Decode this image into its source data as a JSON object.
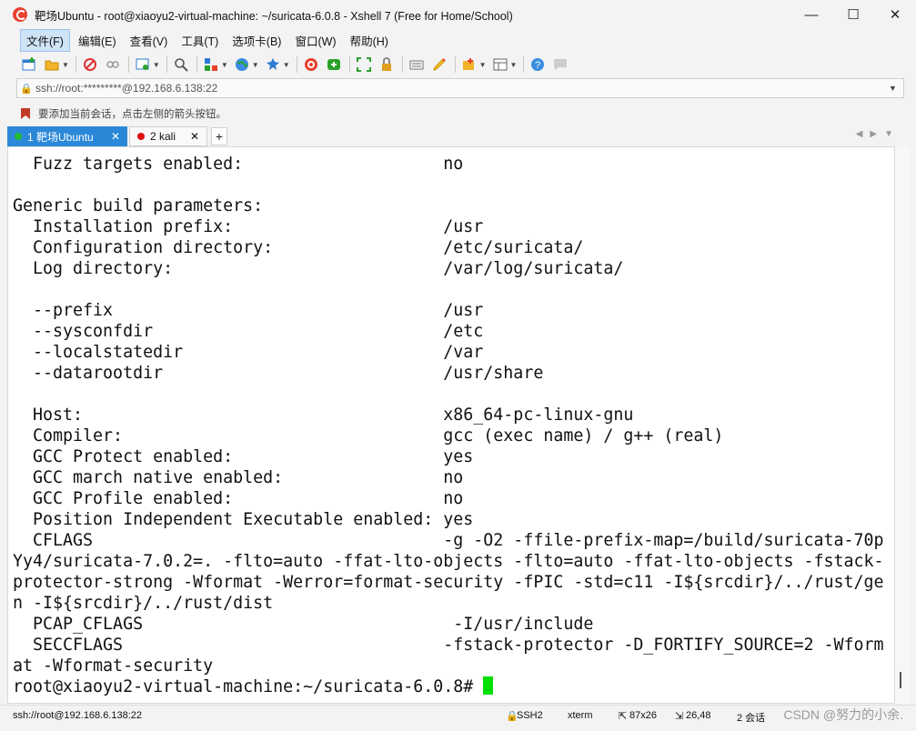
{
  "window": {
    "title": "靶场Ubuntu - root@xiaoyu2-virtual-machine: ~/suricata-6.0.8 - Xshell 7 (Free for Home/School)",
    "minimize": "—",
    "maximize": "☐",
    "close": "✕"
  },
  "menu": {
    "items": [
      "文件(F)",
      "编辑(E)",
      "查看(V)",
      "工具(T)",
      "选项卡(B)",
      "窗口(W)",
      "帮助(H)"
    ]
  },
  "address": {
    "value": "ssh://root:*********@192.168.6.138:22"
  },
  "hint": {
    "text": "要添加当前会话，点击左侧的箭头按钮。"
  },
  "tabs": [
    {
      "label": "1 靶场Ubuntu",
      "close": "✕",
      "dot_color": "#22bb33"
    },
    {
      "label": "2 kali",
      "close": "✕",
      "dot_color": "#e01010"
    }
  ],
  "tab_add": "+",
  "terminal": {
    "lines": [
      "  Fuzz targets enabled:                    no",
      "",
      "Generic build parameters:",
      "  Installation prefix:                     /usr",
      "  Configuration directory:                 /etc/suricata/",
      "  Log directory:                           /var/log/suricata/",
      "",
      "  --prefix                                 /usr",
      "  --sysconfdir                             /etc",
      "  --localstatedir                          /var",
      "  --datarootdir                            /usr/share",
      "",
      "  Host:                                    x86_64-pc-linux-gnu",
      "  Compiler:                                gcc (exec name) / g++ (real)",
      "  GCC Protect enabled:                     yes",
      "  GCC march native enabled:                no",
      "  GCC Profile enabled:                     no",
      "  Position Independent Executable enabled: yes",
      "  CFLAGS                                   -g -O2 -ffile-prefix-map=/build/suricata-70p",
      "Yy4/suricata-7.0.2=. -flto=auto -ffat-lto-objects -flto=auto -ffat-lto-objects -fstack-",
      "protector-strong -Wformat -Werror=format-security -fPIC -std=c11 -I${srcdir}/../rust/ge",
      "n -I${srcdir}/../rust/dist",
      "  PCAP_CFLAGS                               -I/usr/include",
      "  SECCFLAGS                                -fstack-protector -D_FORTIFY_SOURCE=2 -Wform",
      "at -Wformat-security"
    ],
    "prompt": "root@xiaoyu2-virtual-machine:~/suricata-6.0.8# "
  },
  "status": {
    "connection": "ssh://root@192.168.6.138:22",
    "protocol": "SSH2",
    "term": "xterm",
    "size": "87x26",
    "cursor": "26,48",
    "sessions": "2 会话"
  },
  "watermark": "CSDN @努力的小余."
}
